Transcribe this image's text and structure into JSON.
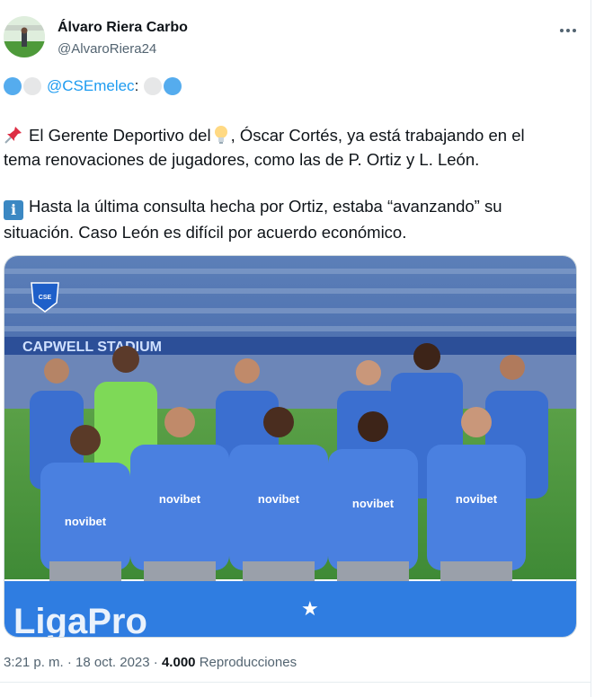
{
  "author": {
    "display_name": "Álvaro Riera Carbo",
    "handle": "@AlvaroRiera24"
  },
  "tweet": {
    "mention": "@CSEmelec",
    "mention_suffix": ":",
    "paragraph1": "El Gerente Deportivo del , Óscar Cortés, ya está trabajando en el tema renovaciones de jugadores, como las de P. Ortiz y L. León.",
    "paragraph1_before": "El Gerente Deportivo del",
    "paragraph1_after": ", Óscar Cortés, ya está trabajando en el tema renovaciones de jugadores, como las de P. Ortiz y L. León.",
    "paragraph2": "Hasta la última consulta hecha por Ortiz, estaba “avanzando” su situación. Caso León es difícil por acuerdo económico.",
    "info_glyph": "i",
    "icons": [
      "pushpin-icon",
      "lightbulb-icon",
      "information-icon",
      "blue-circle-icon",
      "white-circle-icon"
    ]
  },
  "photo": {
    "description_alt": "team-photo",
    "stadium_text": "CAPWELL STADIUM",
    "sponsor": "novibet",
    "banner_text": "LigaPro"
  },
  "footer": {
    "time": "3:21 p. m.",
    "separator": "·",
    "date": "18 oct. 2023",
    "views_count": "4.000",
    "views_label": "Reproducciones"
  },
  "colors": {
    "text": "#0f1419",
    "muted": "#536471",
    "link": "#1d9bf0",
    "emelec_blue": "#2f6fd6"
  }
}
